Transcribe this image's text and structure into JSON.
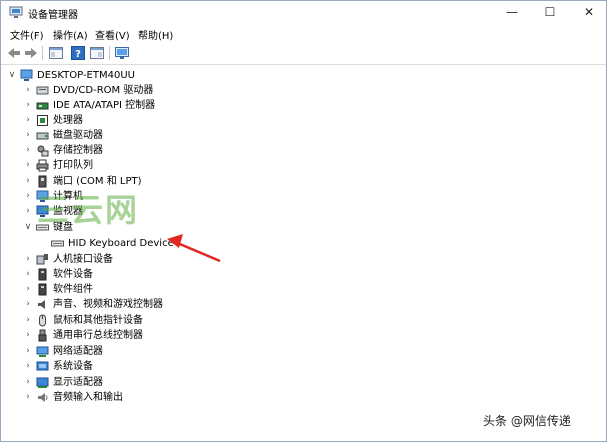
{
  "window": {
    "title": "设备管理器",
    "controls": {
      "minimize": "—",
      "maximize": "☐",
      "close": "✕"
    }
  },
  "menu": [
    {
      "label": "文件(F)"
    },
    {
      "label": "操作(A)"
    },
    {
      "label": "查看(V)"
    },
    {
      "label": "帮助(H)"
    }
  ],
  "tree": {
    "root": {
      "label": "DESKTOP-ETM40UU"
    },
    "categories": [
      {
        "label": "DVD/CD-ROM 驱动器",
        "icon": "dvd-icon"
      },
      {
        "label": "IDE ATA/ATAPI 控制器",
        "icon": "ide-controller-icon"
      },
      {
        "label": "处理器",
        "icon": "processor-icon"
      },
      {
        "label": "磁盘驱动器",
        "icon": "disk-drive-icon"
      },
      {
        "label": "存储控制器",
        "icon": "storage-controller-icon"
      },
      {
        "label": "打印队列",
        "icon": "printer-icon"
      },
      {
        "label": "端口 (COM 和 LPT)",
        "icon": "port-icon"
      },
      {
        "label": "计算机",
        "icon": "computer-icon"
      },
      {
        "label": "监视器",
        "icon": "monitor-icon"
      },
      {
        "label": "键盘",
        "icon": "keyboard-icon",
        "expanded": true,
        "children": [
          {
            "label": "HID Keyboard Device",
            "icon": "keyboard-icon"
          }
        ]
      },
      {
        "label": "人机接口设备",
        "icon": "hid-icon"
      },
      {
        "label": "软件设备",
        "icon": "software-device-icon"
      },
      {
        "label": "软件组件",
        "icon": "software-component-icon"
      },
      {
        "label": "声音、视频和游戏控制器",
        "icon": "sound-icon"
      },
      {
        "label": "鼠标和其他指针设备",
        "icon": "mouse-icon"
      },
      {
        "label": "通用串行总线控制器",
        "icon": "usb-icon"
      },
      {
        "label": "网络适配器",
        "icon": "network-adapter-icon"
      },
      {
        "label": "系统设备",
        "icon": "system-device-icon"
      },
      {
        "label": "显示适配器",
        "icon": "display-adapter-icon"
      },
      {
        "label": "音频输入和输出",
        "icon": "audio-io-icon"
      }
    ]
  },
  "overlays": {
    "watermark": "三云网",
    "attribution": "头条 @网信传递",
    "arrow_color": "#e0281e"
  }
}
